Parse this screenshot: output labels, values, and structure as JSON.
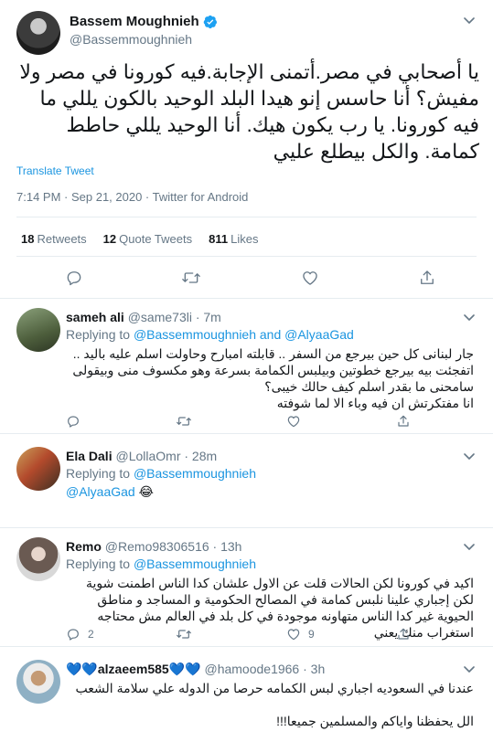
{
  "main_tweet": {
    "name": "Bassem Moughnieh",
    "handle": "@Bassemmoughnieh",
    "text": "يا أصحابي في مصر.أتمنى الإجابة.فيه كورونا في مصر ولا مفيش؟ أنا حاسس إنو هيدا البلد الوحيد بالكون يللي ما فيه كورونا. يا رب يكون هيك. أنا الوحيد يللي حاطط كمامة. والكل بيطلع عليي",
    "translate_label": "Translate Tweet",
    "meta": "7:14 PM · Sep 21, 2020 · Twitter for Android",
    "stats": {
      "retweets_count": "18",
      "retweets_label": "Retweets",
      "quotes_count": "12",
      "quotes_label": "Quote Tweets",
      "likes_count": "811",
      "likes_label": "Likes"
    }
  },
  "replies": [
    {
      "name": "sameh ali",
      "handle_time": "@same73li · 7m",
      "replying_prefix": "Replying to",
      "replying_to": "@Bassemmoughnieh and @AlyaaGad",
      "text": "جار لبنانى كل حين بيرجع من السفر .. قابلته امبارح وحاولت اسلم عليه باليد .. اتفجئت بيه بيرجع خطوتين وبيلبس الكمامة بسرعة وهو مكسوف منى وبيقولى سامحنى ما بقدر اسلم كيف حالك خيبى؟\nانا مفتكرتش ان فيه وباء الا لما شوفته",
      "reply_count": "",
      "retweet_count": "",
      "like_count": ""
    },
    {
      "name": "Ela Dali",
      "handle_time": "@LollaOmr · 28m",
      "replying_prefix": "Replying to",
      "replying_to": "@Bassemmoughnieh",
      "mention": "@AlyaaGad",
      "emoji": "😂"
    },
    {
      "name": "Remo",
      "handle_time": "@Remo98306516 · 13h",
      "replying_prefix": "Replying to",
      "replying_to": "@Bassemmoughnieh",
      "text": "اكيد في كورونا لكن الحالات قلت عن الاول علشان كدا الناس اطمنت شوية لكن إجباري علينا نلبس كمامة في المصالح الحكومية و المساجد و مناطق الحيوية غير كدا الناس متهاونه موجودة في كل بلد في العالم مش محتاجه استغراب منك يعني",
      "reply_count": "2",
      "retweet_count": "",
      "like_count": "9"
    },
    {
      "name": "alzaeem585",
      "hearts_before": "💙💙",
      "hearts_after": "💙💙",
      "handle_time": "@hamoode1966 · 3h",
      "text": "عندنا في السعوديه اجباري لبس الكمامه حرصا من الدوله علي سلامة الشعب\n\nالل يحفظنا واياكم والمسلمين جميعا!!!"
    }
  ],
  "icons": {
    "reply": "reply-icon",
    "retweet": "retweet-icon",
    "like": "heart-icon",
    "share": "share-icon",
    "more": "chevron-down-icon",
    "verified": "verified-badge-icon"
  },
  "colors": {
    "link": "#1b95e0",
    "muted": "#657786",
    "verified": "#1da1f2",
    "border": "#e6ecf0"
  }
}
